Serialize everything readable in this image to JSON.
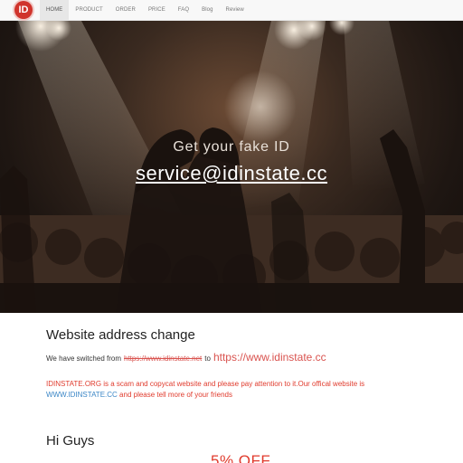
{
  "nav": {
    "logo_text": "ID",
    "items": [
      {
        "label": "HOME",
        "active": true
      },
      {
        "label": "PRODUCT"
      },
      {
        "label": "ORDER"
      },
      {
        "label": "PRICE"
      },
      {
        "label": "FAQ"
      },
      {
        "label": "Blog"
      },
      {
        "label": "Review"
      }
    ]
  },
  "hero": {
    "title": "Get your fake ID",
    "email": "service@idinstate.cc"
  },
  "notice_section": {
    "title": "Website address change",
    "switch_prefix": "We have switched from",
    "old_url": "https://www.idinstate.net",
    "switch_to": "to",
    "new_url": "https://www.idinstate.cc",
    "warning_text": "IDINSTATE.ORG is a scam and copycat website and please pay attention to it.Our offical website is",
    "official_site": "WWW.IDINSTATE.CC",
    "warning_suffix": "and please tell more of your friends"
  },
  "greeting": {
    "title": "Hi Guys",
    "promo": "5% OFF"
  },
  "colors": {
    "accent_red": "#e03b2d",
    "link_blue": "#3b86c6",
    "logo_red": "#d0342c"
  }
}
